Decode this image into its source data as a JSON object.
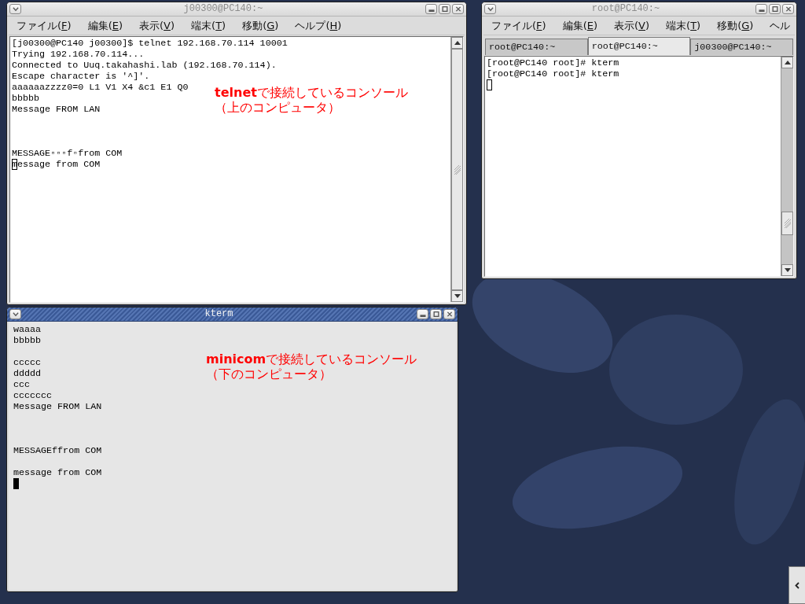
{
  "windows": [
    {
      "kind": "menu_terminal",
      "title": "j00300@PC140:~",
      "active": false,
      "menu": [
        {
          "text": "ファイル(",
          "mnemonic": "F",
          "suffix": ")"
        },
        {
          "text": "編集(",
          "mnemonic": "E",
          "suffix": ")"
        },
        {
          "text": "表示(",
          "mnemonic": "V",
          "suffix": ")"
        },
        {
          "text": "端末(",
          "mnemonic": "T",
          "suffix": ")"
        },
        {
          "text": "移動(",
          "mnemonic": "G",
          "suffix": ")"
        },
        {
          "text": "ヘルプ(",
          "mnemonic": "H",
          "suffix": ")"
        }
      ],
      "lines": [
        {
          "kind": "text",
          "text": "[j00300@PC140 j00300]$ telnet 192.168.70.114 10001"
        },
        {
          "kind": "text",
          "text": "Trying 192.168.70.114..."
        },
        {
          "kind": "text",
          "text": "Connected to Uuq.takahashi.lab (192.168.70.114)."
        },
        {
          "kind": "text",
          "text": "Escape character is '^]'."
        },
        {
          "kind": "text",
          "text": "aaaaaazzzz0=0 L1 V1 X4 &c1 E1 Q0"
        },
        {
          "kind": "text",
          "text": "bbbbb"
        },
        {
          "kind": "text",
          "text": "Message FROM LAN"
        },
        {
          "kind": "blank"
        },
        {
          "kind": "blank"
        },
        {
          "kind": "blank"
        },
        {
          "kind": "text",
          "text": "MESSAGE▫▫▫f▫from COM"
        },
        {
          "kind": "text",
          "text": "message from COM",
          "cursor": true
        }
      ],
      "scrollbar": {
        "fits": true
      },
      "annotation": {
        "lines": [
          "**telnet**で接続しているコンソール",
          "（上のコンピュータ）"
        ]
      }
    },
    {
      "kind": "menu_terminal",
      "title": "root@PC140:~",
      "active": false,
      "menu": [
        {
          "text": "ファイル(",
          "mnemonic": "F",
          "suffix": ")"
        },
        {
          "text": "編集(",
          "mnemonic": "E",
          "suffix": ")"
        },
        {
          "text": "表示(",
          "mnemonic": "V",
          "suffix": ")"
        },
        {
          "text": "端末(",
          "mnemonic": "T",
          "suffix": ")"
        },
        {
          "text": "移動(",
          "mnemonic": "G",
          "suffix": ")"
        },
        {
          "text": "ヘル"
        }
      ],
      "tabs": [
        {
          "label": "root@PC140:~",
          "selected": false
        },
        {
          "label": "root@PC140:~",
          "selected": true
        },
        {
          "label": "j00300@PC140:~",
          "selected": false
        }
      ],
      "lines": [
        {
          "kind": "text",
          "text": "[root@PC140 root]# kterm"
        },
        {
          "kind": "text",
          "text": "[root@PC140 root]# kterm"
        },
        {
          "kind": "blank",
          "cursor": true
        }
      ],
      "scrollbar": {
        "fits": false
      }
    },
    {
      "kind": "bare_terminal",
      "title": "kterm",
      "active": true,
      "lines": [
        {
          "kind": "text",
          "text": "waaaa"
        },
        {
          "kind": "text",
          "text": "bbbbb"
        },
        {
          "kind": "blank"
        },
        {
          "kind": "text",
          "text": "ccccc"
        },
        {
          "kind": "text",
          "text": "ddddd"
        },
        {
          "kind": "text",
          "text": "ccc"
        },
        {
          "kind": "text",
          "text": "ccccccc"
        },
        {
          "kind": "text",
          "text": "Message FROM LAN"
        },
        {
          "kind": "blank"
        },
        {
          "kind": "blank"
        },
        {
          "kind": "blank"
        },
        {
          "kind": "text",
          "text": "MESSAGEffrom COM"
        },
        {
          "kind": "blank"
        },
        {
          "kind": "text",
          "text": "message from COM"
        },
        {
          "kind": "blank",
          "cursor": true
        }
      ],
      "annotation": {
        "lines": [
          "**minicom**で接続しているコンソール",
          "（下のコンピュータ）"
        ]
      }
    }
  ]
}
